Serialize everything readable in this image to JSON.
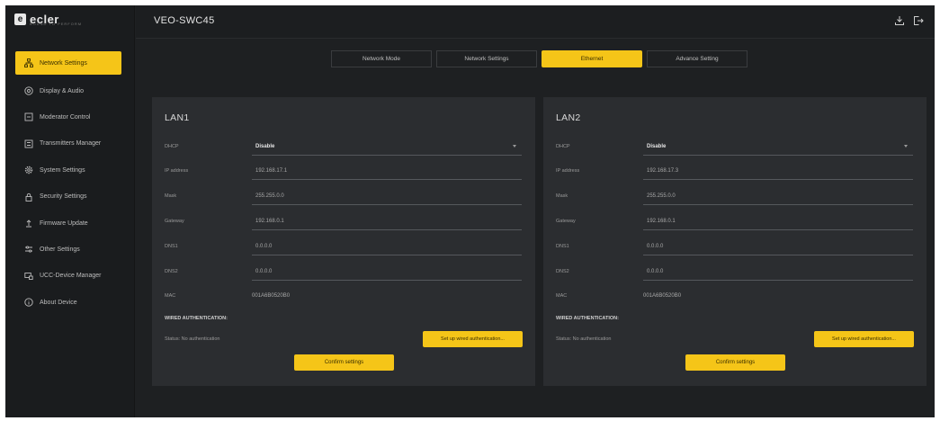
{
  "brand": {
    "logo_mark": "e",
    "logo_text": "ecler",
    "logo_sub": "BOUND TO PERFORM"
  },
  "header": {
    "device_name": "VEO-SWC45",
    "icons": [
      "download-icon",
      "logout-icon"
    ]
  },
  "sidebar": {
    "items": [
      {
        "label": "Network Settings",
        "icon": "network-icon",
        "active": true
      },
      {
        "label": "Display & Audio",
        "icon": "display-audio-icon"
      },
      {
        "label": "Moderator Control",
        "icon": "moderator-icon"
      },
      {
        "label": "Transmitters Manager",
        "icon": "transmitter-icon"
      },
      {
        "label": "System Settings",
        "icon": "gear-icon"
      },
      {
        "label": "Security Settings",
        "icon": "lock-icon"
      },
      {
        "label": "Firmware Update",
        "icon": "upload-icon"
      },
      {
        "label": "Other Settings",
        "icon": "sliders-icon"
      },
      {
        "label": "UCC-Device Manager",
        "icon": "device-manager-icon"
      },
      {
        "label": "About Device",
        "icon": "info-icon"
      }
    ]
  },
  "tabs": [
    {
      "label": "Network Mode"
    },
    {
      "label": "Network Settings"
    },
    {
      "label": "Ethernet",
      "active": true
    },
    {
      "label": "Advance Setting"
    }
  ],
  "lan1": {
    "title": "LAN1",
    "fields": {
      "dhcp": {
        "label": "DHCP",
        "value": "Disable"
      },
      "ip": {
        "label": "IP address",
        "value": "192.168.17.1"
      },
      "mask": {
        "label": "Mask",
        "value": "255.255.0.0"
      },
      "gateway": {
        "label": "Gateway",
        "value": "192.168.0.1"
      },
      "dns1": {
        "label": "DNS1",
        "value": "0.0.0.0"
      },
      "dns2": {
        "label": "DNS2",
        "value": "0.0.0.0"
      },
      "mac": {
        "label": "MAC",
        "value": "001A6B0520B0"
      }
    },
    "wired_title": "WIRED AUTHENTICATION:",
    "status": "Status: No authentication",
    "auth_button": "Set up wired authentication...",
    "confirm_button": "Confirm settings"
  },
  "lan2": {
    "title": "LAN2",
    "fields": {
      "dhcp": {
        "label": "DHCP",
        "value": "Disable"
      },
      "ip": {
        "label": "IP address",
        "value": "192.168.17.3"
      },
      "mask": {
        "label": "Mask",
        "value": "255.255.0.0"
      },
      "gateway": {
        "label": "Gateway",
        "value": "192.168.0.1"
      },
      "dns1": {
        "label": "DNS1",
        "value": "0.0.0.0"
      },
      "dns2": {
        "label": "DNS2",
        "value": "0.0.0.0"
      },
      "mac": {
        "label": "MAC",
        "value": "001A6B0520B0"
      }
    },
    "wired_title": "WIRED AUTHENTICATION:",
    "status": "Status: No authentication",
    "auth_button": "Set up wired authentication...",
    "confirm_button": "Confirm settings"
  },
  "colors": {
    "accent": "#f5c518",
    "background": "#1e2022",
    "panel": "#2b2d30"
  }
}
